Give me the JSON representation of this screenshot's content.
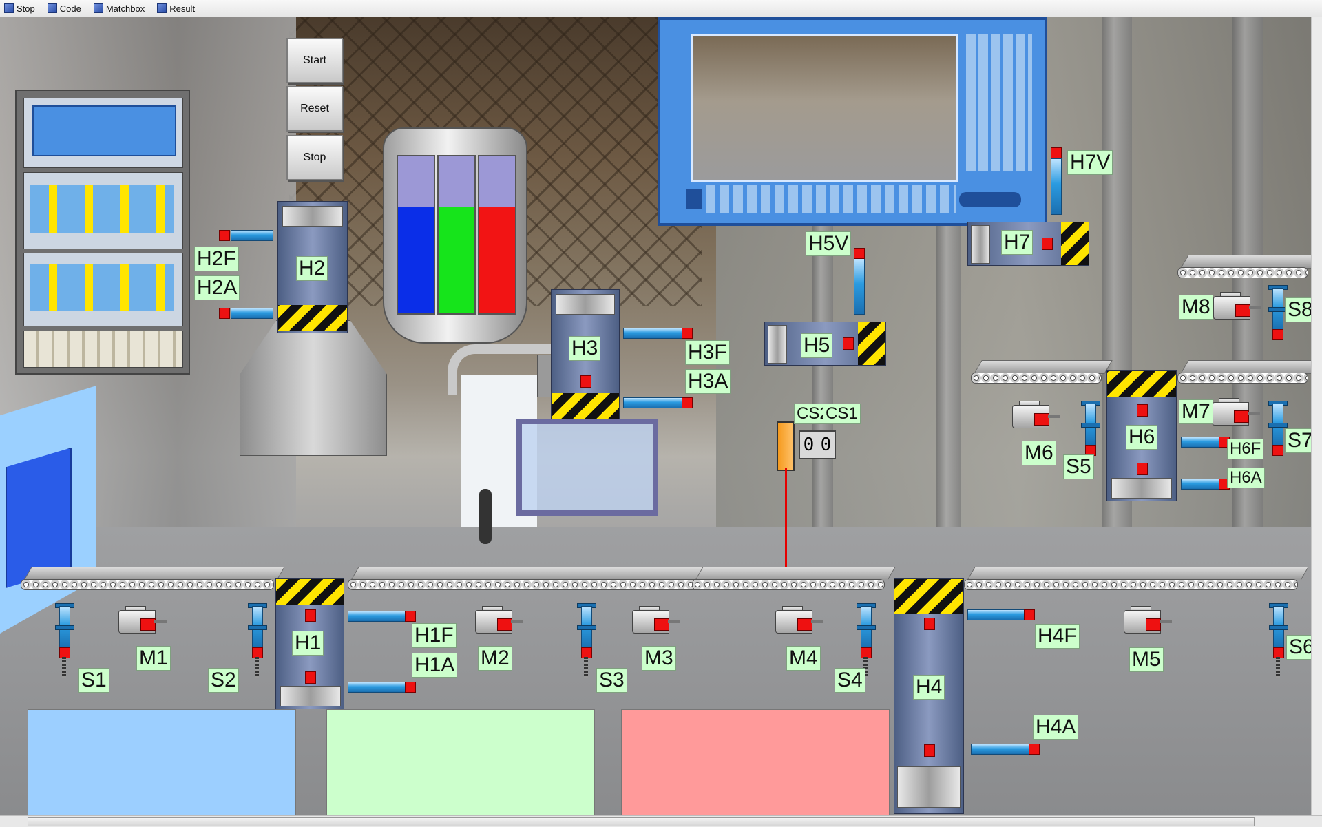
{
  "menubar": {
    "items": [
      {
        "label": "Stop",
        "icon": "stop-icon"
      },
      {
        "label": "Code",
        "icon": "code-icon"
      },
      {
        "label": "Matchbox",
        "icon": "matchbox-icon"
      },
      {
        "label": "Result",
        "icon": "result-icon"
      }
    ]
  },
  "controls": {
    "start": "Start",
    "reset": "Reset",
    "stop": "Stop"
  },
  "tank": {
    "levels": {
      "blue": 0.68,
      "green": 0.68,
      "red": 0.68
    },
    "colors": {
      "blue": "#0a2ee8",
      "green": "#16e41b",
      "red": "#f21414",
      "empty": "#9c98d6"
    }
  },
  "labels": {
    "h1": "H1",
    "h1f": "H1F",
    "h1a": "H1A",
    "h2": "H2",
    "h2f": "H2F",
    "h2a": "H2A",
    "h3": "H3",
    "h3f": "H3F",
    "h3a": "H3A",
    "h4": "H4",
    "h4f": "H4F",
    "h4a": "H4A",
    "h5": "H5",
    "h5v": "H5V",
    "h6": "H6",
    "h6f": "H6F",
    "h6a": "H6A",
    "h7": "H7",
    "h7v": "H7V",
    "m1": "M1",
    "m2": "M2",
    "m3": "M3",
    "m4": "M4",
    "m5": "M5",
    "m6": "M6",
    "m7": "M7",
    "m8": "M8",
    "s1": "S1",
    "s2": "S2",
    "s3": "S3",
    "s4": "S4",
    "s5": "S5",
    "s6": "S6",
    "s7": "S7",
    "s8": "S8",
    "cs1": "CS1",
    "cs2": "CS2"
  },
  "counters": {
    "cs2": "0",
    "cs1": "0"
  },
  "bins": {
    "blue": "#9ccfff",
    "green": "#ccffcc",
    "red": "#ff9a9a"
  },
  "colors": {
    "label_bg": "#ccffcc",
    "hmi_blue": "#4a90e2",
    "laser": "#e60000"
  }
}
